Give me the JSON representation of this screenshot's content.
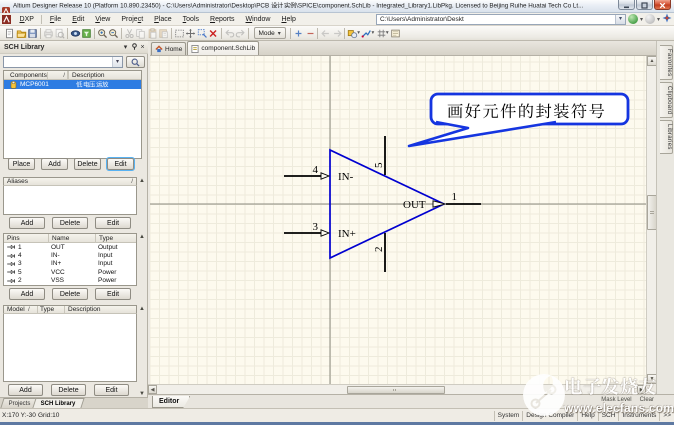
{
  "window": {
    "title": "Altium Designer Release 10 (Platform 10.890.23450) - C:\\Users\\Administrator\\Desktop\\PCB 设计实例\\SPICE\\component.SchLib - Integrated_Library1.LibPkg. Licensed to Beijing Ruihe Huatai Tech Co Lt...",
    "minimize": "minimize",
    "maximize": "maximize",
    "close": "close"
  },
  "menubar": {
    "items": [
      {
        "label": "DXP",
        "u": 0
      },
      {
        "label": "File",
        "u": 0
      },
      {
        "label": "Edit",
        "u": 0
      },
      {
        "label": "View",
        "u": 0
      },
      {
        "label": "Project",
        "u": 5
      },
      {
        "label": "Place",
        "u": 0
      },
      {
        "label": "Tools",
        "u": 0
      },
      {
        "label": "Reports",
        "u": 0
      },
      {
        "label": "Window",
        "u": 0
      },
      {
        "label": "Help",
        "u": 0
      }
    ],
    "path_box": "C:\\Users\\Administrator\\Deskt"
  },
  "toolbar": {
    "mode_label": "Mode",
    "icons": [
      "new-document-icon",
      "open-folder-icon",
      "save-icon",
      "print-icon",
      "print-preview-icon",
      "browse-eye-icon",
      "filter-icon",
      "zoom-in-icon",
      "zoom-out-icon",
      "cut-icon",
      "copy-icon",
      "paste-icon",
      "paste-array-icon",
      "select-area-icon",
      "move-icon",
      "selection-zoom-icon",
      "clear-filter-icon",
      "undo-icon",
      "redo-icon",
      "plus-icon",
      "minus-icon",
      "back-icon",
      "forward-icon",
      "drawing-tools-icon",
      "wiring-tools-icon",
      "grid-tools-icon",
      "sheet-tools-icon"
    ]
  },
  "doc_tabs": [
    {
      "label": "Home"
    },
    {
      "label": "component.SchLib"
    }
  ],
  "sch_library_panel": {
    "caption": "SCH Library",
    "search_value": "",
    "components": {
      "headers": [
        "Components",
        "Description"
      ],
      "sort_mark": "/",
      "rows": [
        {
          "name": "MCP6001",
          "description": "低电压运放"
        }
      ],
      "buttons": [
        "Place",
        "Add",
        "Delete",
        "Edit"
      ]
    },
    "aliases": {
      "header": "Aliases",
      "sort_mark": "/",
      "buttons": [
        "Add",
        "Delete",
        "Edit"
      ]
    },
    "pins": {
      "headers": [
        "Pins",
        "Name",
        "Type"
      ],
      "rows": [
        {
          "num": "1",
          "name": "OUT",
          "type": "Output"
        },
        {
          "num": "4",
          "name": "IN-",
          "type": "Input"
        },
        {
          "num": "3",
          "name": "IN+",
          "type": "Input"
        },
        {
          "num": "5",
          "name": "VCC",
          "type": "Power"
        },
        {
          "num": "2",
          "name": "VSS",
          "type": "Power"
        }
      ],
      "buttons": [
        "Add",
        "Delete",
        "Edit"
      ]
    },
    "model": {
      "headers": [
        "Model",
        "Type",
        "Description"
      ],
      "sort_mark": "/",
      "buttons": [
        "Add",
        "Delete",
        "Edit"
      ]
    },
    "bottom_tabs": [
      "Projects",
      "SCH Library"
    ]
  },
  "editor": {
    "callout_text": "画好元件的封装符号",
    "symbol": {
      "pins": [
        {
          "number": "4",
          "name": "IN-"
        },
        {
          "number": "3",
          "name": "IN+"
        },
        {
          "number": "1",
          "name": "OUT"
        },
        {
          "number": "5",
          "name": ""
        },
        {
          "number": "2",
          "name": ""
        }
      ]
    },
    "editor_tab": "Editor",
    "mask_level_label": "Mask Level",
    "clear_label": "Clear",
    "right_tabs": [
      "Favorites",
      "Clipboard",
      "Libraries"
    ]
  },
  "statusbar": {
    "position": "X:170 Y:-30",
    "grid": "Grid:10",
    "buttons": [
      "System",
      "Design Compiler",
      "Help",
      "SCH",
      "Instruments",
      ">>"
    ]
  },
  "watermark": {
    "brand": "电子发烧友",
    "url_text": "www.elecfans.com"
  },
  "colors": {
    "selection_blue": "#2e7ce2",
    "schematic_blue": "#0000d0",
    "callout_blue": "#1535e0",
    "canvas_cream": "#fdfbf0"
  }
}
